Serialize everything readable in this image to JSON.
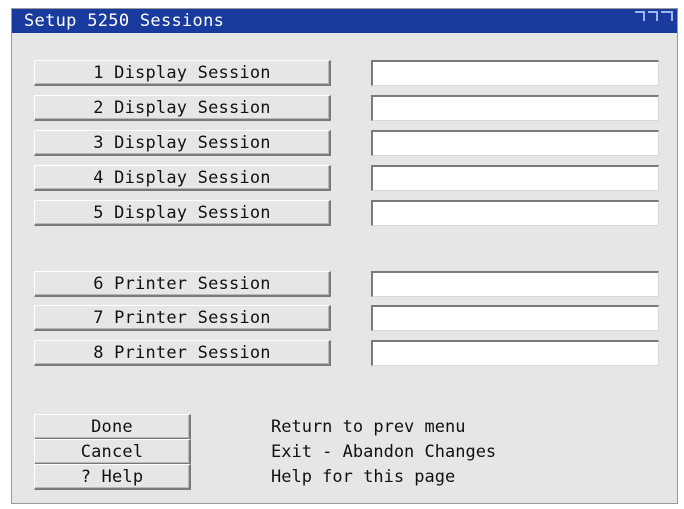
{
  "window": {
    "title": "Setup 5250 Sessions"
  },
  "display_sessions": [
    {
      "label": "1 Display Session",
      "value": ""
    },
    {
      "label": "2 Display Session",
      "value": ""
    },
    {
      "label": "3 Display Session",
      "value": ""
    },
    {
      "label": "4 Display Session",
      "value": ""
    },
    {
      "label": "5 Display Session",
      "value": ""
    }
  ],
  "printer_sessions": [
    {
      "label": "6 Printer Session",
      "value": ""
    },
    {
      "label": "7 Printer Session",
      "value": ""
    },
    {
      "label": "8 Printer Session",
      "value": ""
    }
  ],
  "actions": [
    {
      "label": "Done",
      "description": "Return to prev menu"
    },
    {
      "label": "Cancel",
      "description": "Exit - Abandon Changes"
    },
    {
      "label": "? Help",
      "description": "Help for this page"
    }
  ],
  "colors": {
    "titlebar": "#1a3b9e",
    "background": "#e6e6e6"
  },
  "icons": [
    "window-control-icon"
  ]
}
